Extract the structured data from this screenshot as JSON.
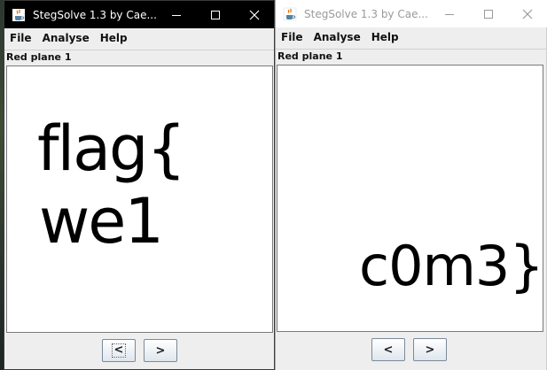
{
  "windows": {
    "left": {
      "title": "StegSolve 1.3 by Cae...",
      "menu": [
        "File",
        "Analyse",
        "Help"
      ],
      "plane_label": "Red plane 1",
      "image_text": [
        "flag{",
        "we1"
      ],
      "prev_label": "<",
      "next_label": ">",
      "state": "active"
    },
    "right": {
      "title": "StegSolve 1.3 by Cae...",
      "menu": [
        "File",
        "Analyse",
        "Help"
      ],
      "plane_label": "Red plane 1",
      "image_text": [
        "c0m3}"
      ],
      "prev_label": "<",
      "next_label": ">",
      "state": "inactive"
    }
  },
  "icons": {
    "app": "java-coffee-cup-icon",
    "minimize": "minimize-icon",
    "maximize": "maximize-icon",
    "close": "close-icon"
  },
  "colors": {
    "active_titlebar": "#000000",
    "inactive_titlebar": "#ffffff",
    "window_bg": "#eeeeee",
    "canvas_bg": "#ffffff"
  }
}
